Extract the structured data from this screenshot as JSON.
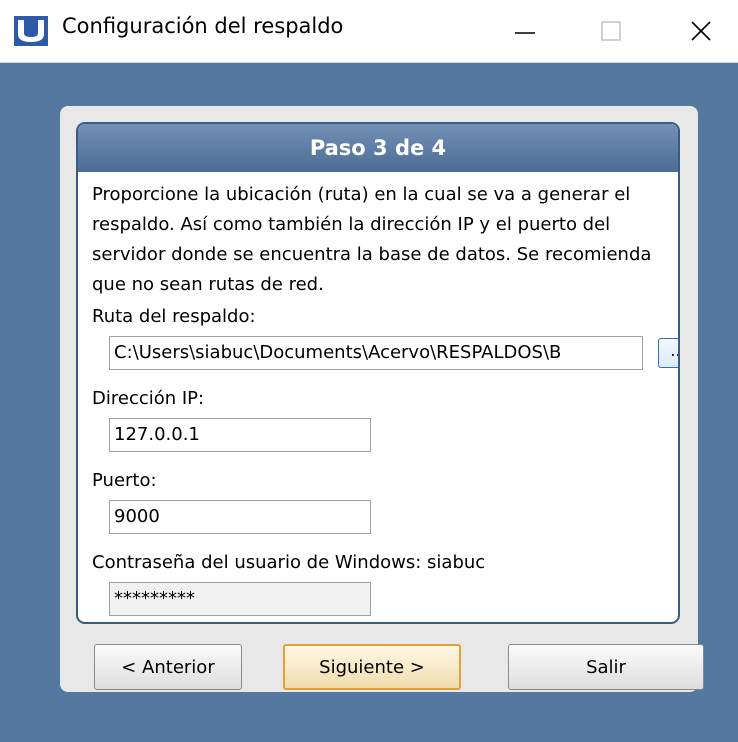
{
  "window": {
    "title": "Configuración del respaldo",
    "controls": {
      "minimize": "—",
      "maximize": "☐",
      "close": "✕"
    }
  },
  "step": {
    "header": "Paso 3 de 4"
  },
  "description": "Proporcione la ubicación (ruta) en la cual se va a generar el respaldo. Así como también la dirección IP y el puerto del servidor donde se encuentra la base de datos. Se recomienda que no sean rutas de red.",
  "fields": {
    "backup_path": {
      "label": "Ruta del respaldo:",
      "value": "C:\\Users\\siabuc\\Documents\\Acervo\\RESPALDOS\\B",
      "browse_label": "..."
    },
    "ip_address": {
      "label": "Dirección IP:",
      "value": "127.0.0.1"
    },
    "port": {
      "label": "Puerto:",
      "value": "9000"
    },
    "password": {
      "label": "Contraseña del  usuario de Windows: siabuc",
      "value": "*********"
    }
  },
  "buttons": {
    "previous": {
      "label": "< Anterior"
    },
    "next": {
      "label": "Siguiente >"
    },
    "exit": {
      "label": "Salir"
    }
  },
  "icons": {
    "app": "app-logo-icon"
  },
  "colors": {
    "background": "#54789f",
    "header": "#5a7aa4",
    "panel_border": "#3c5a86",
    "default_button_border": "#e0a23a"
  }
}
